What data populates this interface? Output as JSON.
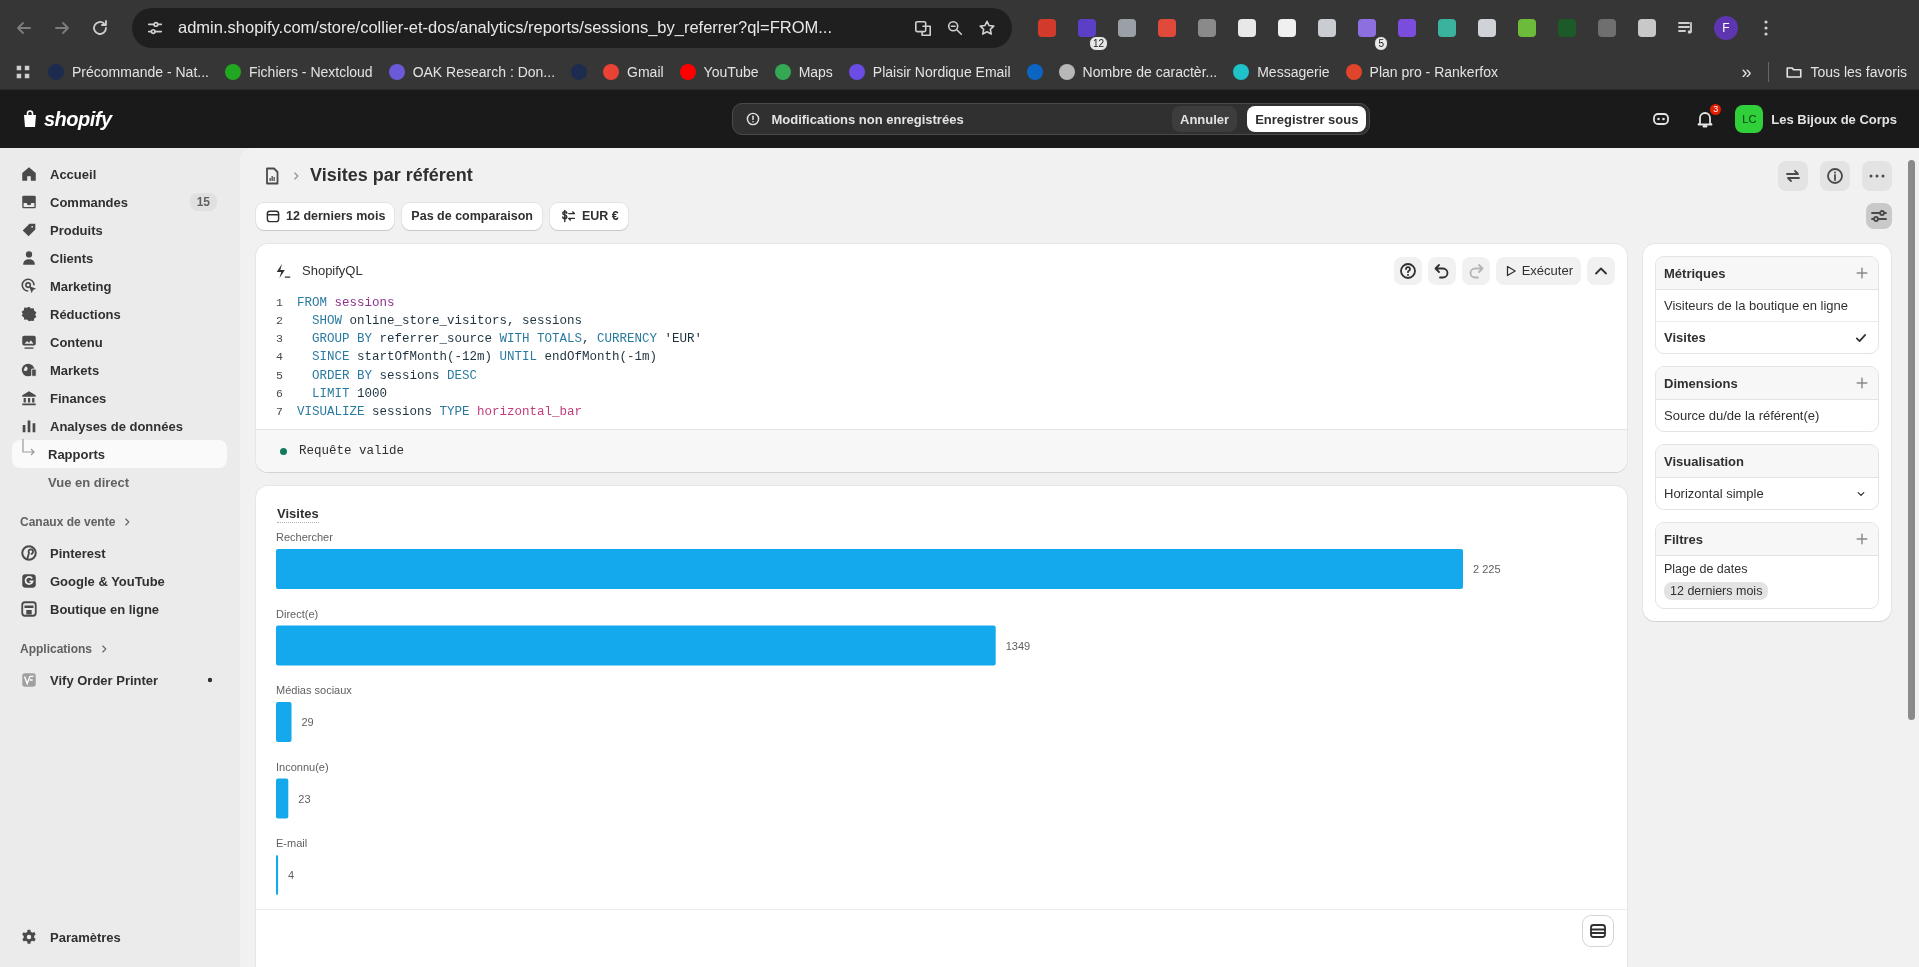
{
  "browser": {
    "url": "admin.shopify.com/store/collier-et-dos/analytics/reports/sessions_by_referrer?ql=FROM...",
    "extensions": [
      {
        "badge": "12"
      },
      {
        "badge": "5"
      }
    ],
    "profile": "F",
    "bookmarks": [
      {
        "kind": "link",
        "label": "Précommande - Nat...",
        "color": "#1d2b4f"
      },
      {
        "kind": "link",
        "label": "Fichiers - Nextcloud",
        "color": "#22a722"
      },
      {
        "kind": "link",
        "label": "OAK Research : Don...",
        "color": "#6a5ad8"
      },
      {
        "kind": "icon-only",
        "color": "#1d2b4f"
      },
      {
        "kind": "link",
        "label": "Gmail",
        "color": "#ea4335"
      },
      {
        "kind": "link",
        "label": "YouTube",
        "color": "#ff0000"
      },
      {
        "kind": "link",
        "label": "Maps",
        "color": "#34a853"
      },
      {
        "kind": "link",
        "label": "Plaisir Nordique Email",
        "color": "#6b4de6"
      },
      {
        "kind": "icon-only",
        "color": "#0a66c2"
      },
      {
        "kind": "link",
        "label": "Nombre de caractèr...",
        "color": "#b8b8b8"
      },
      {
        "kind": "link",
        "label": "Messagerie",
        "color": "#1fc2c8"
      },
      {
        "kind": "link",
        "label": "Plan pro - Rankerfox",
        "color": "#e0452b"
      }
    ],
    "overflow": "»",
    "all_bookmarks": "Tous les favoris"
  },
  "topbar": {
    "logo": "shopify",
    "notice": "Modifications non enregistrées",
    "buttons": [
      {
        "label": "Annuler",
        "kind": "secondary"
      },
      {
        "label": "Enregistrer sous",
        "kind": "primary"
      }
    ],
    "notifications": "3",
    "avatar": "LC",
    "store": "Les Bijoux de Corps"
  },
  "sidebar": {
    "items": [
      {
        "label": "Accueil",
        "selected": false
      },
      {
        "label": "Commandes",
        "badge": "15",
        "selected": false
      },
      {
        "label": "Produits",
        "selected": false
      },
      {
        "label": "Clients",
        "selected": false
      },
      {
        "label": "Marketing",
        "selected": false
      },
      {
        "label": "Réductions",
        "selected": false
      },
      {
        "label": "Contenu",
        "selected": false
      },
      {
        "label": "Markets",
        "selected": false
      },
      {
        "label": "Finances",
        "selected": false
      },
      {
        "label": "Analyses de données",
        "selected": false,
        "children": [
          {
            "label": "Rapports",
            "selected": true
          },
          {
            "label": "Vue en direct",
            "selected": false
          }
        ]
      }
    ],
    "sections": [
      {
        "title": "Canaux de vente",
        "items": [
          {
            "label": "Pinterest",
            "selected": false
          },
          {
            "label": "Google & YouTube",
            "selected": false
          },
          {
            "label": "Boutique en ligne",
            "selected": false
          }
        ]
      },
      {
        "title": "Applications",
        "items": [
          {
            "label": "Vify Order Printer",
            "selected": false,
            "pinned": true
          }
        ]
      }
    ],
    "footer": {
      "label": "Paramètres"
    }
  },
  "page": {
    "title": "Visites par référent",
    "filters": [
      {
        "label": "12 derniers mois",
        "kind": "date"
      },
      {
        "label": "Pas de comparaison",
        "kind": "plain"
      },
      {
        "label": "EUR €",
        "kind": "currency"
      }
    ],
    "panel_toggle": {
      "on": true
    }
  },
  "editor": {
    "title": "ShopifyQL",
    "redo": {
      "disabled": true
    },
    "run": "Exécuter",
    "lines": [
      {
        "number": "1",
        "indent": false,
        "tokens": [
          {
            "text": "FROM",
            "kind": "keyword"
          },
          {
            "text": " sessions",
            "kind": "source"
          }
        ]
      },
      {
        "number": "2",
        "indent": true,
        "tokens": [
          {
            "text": "SHOW",
            "kind": "keyword"
          },
          {
            "text": " online_store_visitors, sessions",
            "kind": "plain"
          }
        ]
      },
      {
        "number": "3",
        "indent": true,
        "tokens": [
          {
            "text": "GROUP BY",
            "kind": "keyword"
          },
          {
            "text": " referrer_source ",
            "kind": "plain"
          },
          {
            "text": "WITH TOTALS",
            "kind": "keyword"
          },
          {
            "text": ", ",
            "kind": "plain"
          },
          {
            "text": "CURRENCY",
            "kind": "keyword"
          },
          {
            "text": " 'EUR'",
            "kind": "string"
          }
        ]
      },
      {
        "number": "4",
        "indent": true,
        "tokens": [
          {
            "text": "SINCE",
            "kind": "keyword"
          },
          {
            "text": " startOfMonth(-12m) ",
            "kind": "plain"
          },
          {
            "text": "UNTIL",
            "kind": "keyword"
          },
          {
            "text": " endOfMonth(-1m)",
            "kind": "plain"
          }
        ]
      },
      {
        "number": "5",
        "indent": true,
        "tokens": [
          {
            "text": "ORDER BY",
            "kind": "keyword"
          },
          {
            "text": " sessions ",
            "kind": "plain"
          },
          {
            "text": "DESC",
            "kind": "keyword"
          }
        ]
      },
      {
        "number": "6",
        "indent": true,
        "tokens": [
          {
            "text": "LIMIT",
            "kind": "keyword"
          },
          {
            "text": " 1000",
            "kind": "plain"
          }
        ]
      },
      {
        "number": "7",
        "indent": false,
        "tokens": [
          {
            "text": "VISUALIZE",
            "kind": "keyword"
          },
          {
            "text": " sessions ",
            "kind": "plain"
          },
          {
            "text": "TYPE",
            "kind": "keyword"
          },
          {
            "text": " horizontal_bar",
            "kind": "viz"
          }
        ]
      }
    ],
    "status": "Requête valide",
    "valid": true
  },
  "chart_card": {
    "chart_data": {
      "type": "bar",
      "orientation": "horizontal",
      "categories": [
        "Rechercher",
        "Direct(e)",
        "Médias sociaux",
        "Inconnu(e)",
        "E-mail"
      ],
      "series": [
        {
          "name": "Visites",
          "color": "#14a9ec",
          "values": [
            2225,
            1349,
            29,
            23,
            4
          ]
        }
      ],
      "data_labels": true,
      "value_labels": [
        "2 225",
        "1349",
        "29",
        "23",
        "4"
      ]
    }
  },
  "panel": {
    "sections": [
      {
        "title": "Métriques",
        "addable": true,
        "items": [
          {
            "kind": "option",
            "label": "Visiteurs de la boutique en ligne",
            "checked": false
          },
          {
            "kind": "option",
            "label": "Visites",
            "checked": true
          }
        ]
      },
      {
        "title": "Dimensions",
        "addable": true,
        "items": [
          {
            "kind": "option",
            "label": "Source du/de la référent(e)",
            "checked": false
          }
        ]
      },
      {
        "title": "Visualisation",
        "addable": false,
        "items": [
          {
            "kind": "select",
            "label": "Horizontal simple"
          }
        ]
      },
      {
        "title": "Filtres",
        "addable": true,
        "items": [
          {
            "kind": "filter",
            "label": "Plage de dates",
            "value": "12 derniers mois"
          }
        ]
      }
    ]
  }
}
